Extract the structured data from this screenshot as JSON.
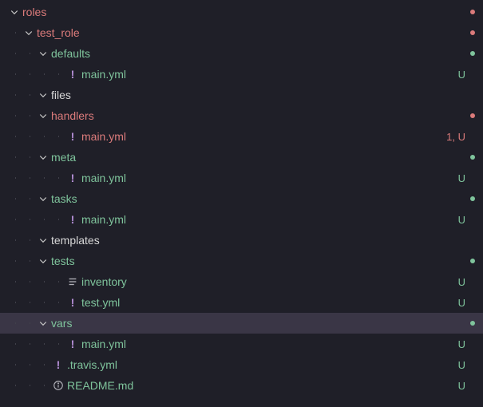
{
  "badges": {
    "untracked": "U",
    "problem_untracked": "1, U"
  },
  "tree": [
    {
      "kind": "folder",
      "depth": 1,
      "label": "roles",
      "color": "red",
      "expanded": true,
      "dot": "red"
    },
    {
      "kind": "folder",
      "depth": 2,
      "label": "test_role",
      "color": "red",
      "expanded": true,
      "dot": "red"
    },
    {
      "kind": "folder",
      "depth": 3,
      "label": "defaults",
      "color": "green",
      "expanded": true,
      "dot": "green"
    },
    {
      "kind": "file",
      "depth": 4,
      "label": "main.yml",
      "color": "green",
      "icon": "bang",
      "badge": "untracked"
    },
    {
      "kind": "folder",
      "depth": 3,
      "label": "files",
      "color": "white",
      "expanded": true
    },
    {
      "kind": "folder",
      "depth": 3,
      "label": "handlers",
      "color": "red",
      "expanded": true,
      "dot": "red"
    },
    {
      "kind": "file",
      "depth": 4,
      "label": "main.yml",
      "color": "red",
      "icon": "bang",
      "badge": "problem_untracked"
    },
    {
      "kind": "folder",
      "depth": 3,
      "label": "meta",
      "color": "green",
      "expanded": true,
      "dot": "green"
    },
    {
      "kind": "file",
      "depth": 4,
      "label": "main.yml",
      "color": "green",
      "icon": "bang",
      "badge": "untracked"
    },
    {
      "kind": "folder",
      "depth": 3,
      "label": "tasks",
      "color": "green",
      "expanded": true,
      "dot": "green"
    },
    {
      "kind": "file",
      "depth": 4,
      "label": "main.yml",
      "color": "green",
      "icon": "bang",
      "badge": "untracked"
    },
    {
      "kind": "folder",
      "depth": 3,
      "label": "templates",
      "color": "white",
      "expanded": true
    },
    {
      "kind": "folder",
      "depth": 3,
      "label": "tests",
      "color": "green",
      "expanded": true,
      "dot": "green"
    },
    {
      "kind": "file",
      "depth": 4,
      "label": "inventory",
      "color": "green",
      "icon": "lines",
      "badge": "untracked"
    },
    {
      "kind": "file",
      "depth": 4,
      "label": "test.yml",
      "color": "green",
      "icon": "bang",
      "badge": "untracked"
    },
    {
      "kind": "folder",
      "depth": 3,
      "label": "vars",
      "color": "green",
      "expanded": true,
      "dot": "green",
      "selected": true
    },
    {
      "kind": "file",
      "depth": 4,
      "label": "main.yml",
      "color": "green",
      "icon": "bang",
      "badge": "untracked"
    },
    {
      "kind": "file",
      "depth": 3,
      "label": ".travis.yml",
      "color": "green",
      "icon": "bang",
      "badge": "untracked"
    },
    {
      "kind": "file",
      "depth": 3,
      "label": "README.md",
      "color": "green",
      "icon": "info",
      "badge": "untracked"
    }
  ]
}
